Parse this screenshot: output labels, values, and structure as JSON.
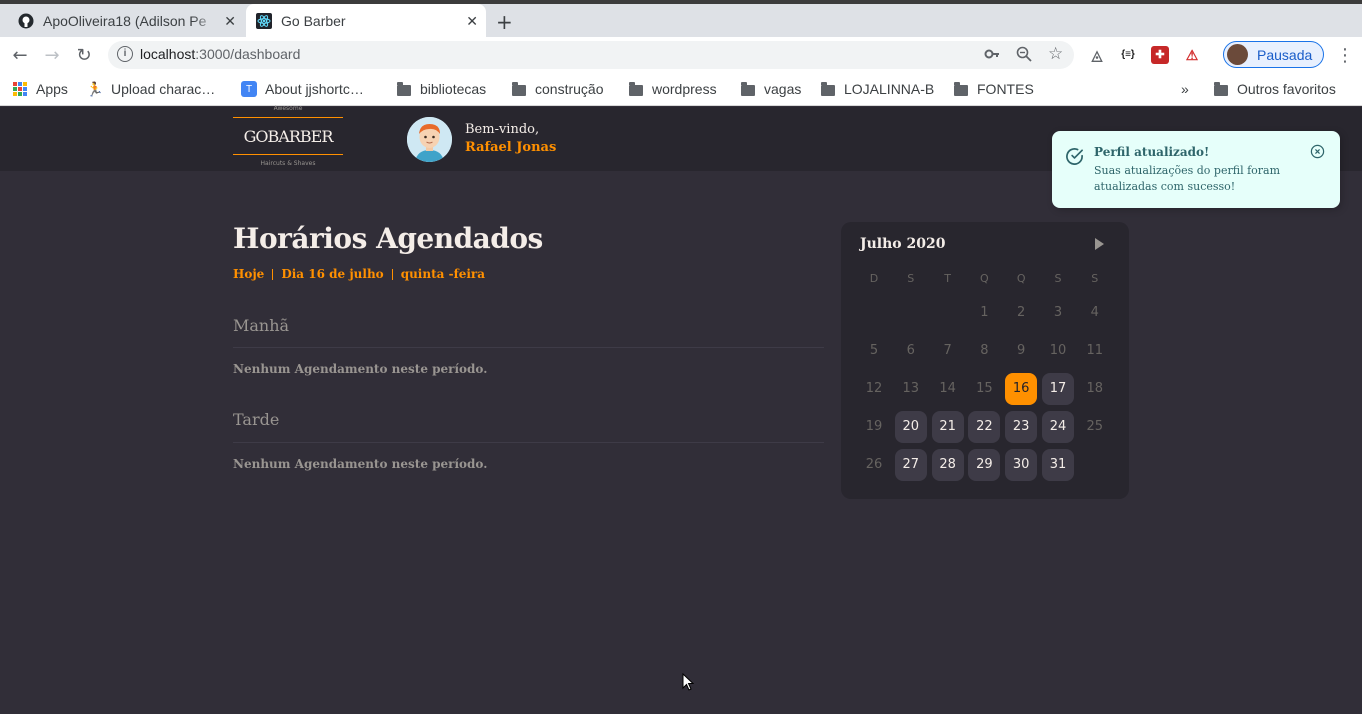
{
  "browser": {
    "tabs": [
      {
        "label": "ApoOliveira18 (Adilson Pe",
        "icon": "github-icon"
      },
      {
        "label": "Go Barber",
        "icon": "react-icon"
      }
    ],
    "url_host": "localhost",
    "url_path": ":3000/dashboard",
    "profile_label": "Pausada",
    "bookmarks": [
      "Apps",
      "Upload charac…",
      "About jjshortc…",
      "bibliotecas",
      "construção",
      "wordpress",
      "vagas",
      "LOJALINNA-B",
      "FONTES"
    ],
    "more_bookmarks": "»",
    "other_bookmarks": "Outros favoritos"
  },
  "header": {
    "logo_top": "Awesome",
    "logo_main": "GOBARBER",
    "logo_bottom": "Haircuts & Shaves",
    "welcome": "Bem-vindo,",
    "user_name": "Rafael Jonas"
  },
  "toast": {
    "title": "Perfil atualizado!",
    "description": "Suas atualizações do perfil foram atualizadas com sucesso!"
  },
  "schedule": {
    "title": "Horários Agendados",
    "today": "Hoje",
    "date": "Dia 16 de julho",
    "weekday": "quinta -feira",
    "morning_title": "Manhã",
    "morning_empty": "Nenhum Agendamento neste período.",
    "afternoon_title": "Tarde",
    "afternoon_empty": "Nenhum Agendamento neste período."
  },
  "calendar": {
    "month": "Julho 2020",
    "weekdays": [
      "D",
      "S",
      "T",
      "Q",
      "Q",
      "S",
      "S"
    ],
    "first_weekday": 3,
    "days_in_month": 31,
    "selected_day": 16,
    "available_days": [
      17,
      20,
      21,
      22,
      23,
      24,
      27,
      28,
      29,
      30,
      31
    ],
    "accent_color": "#ff9000"
  }
}
